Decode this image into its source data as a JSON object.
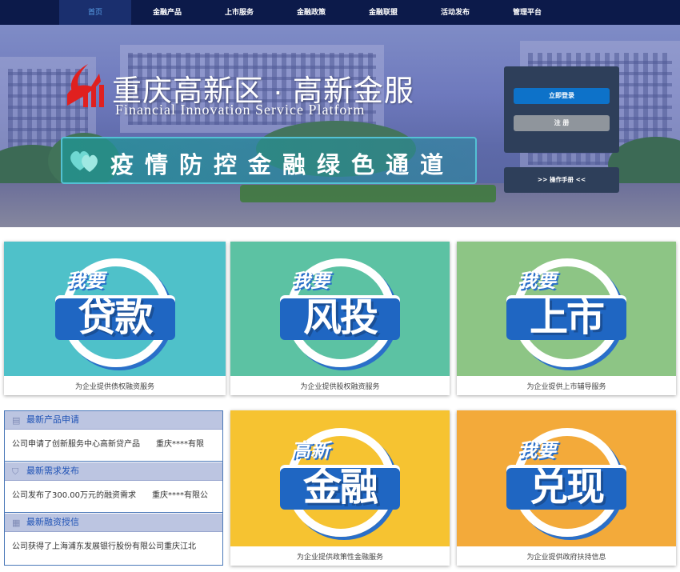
{
  "nav": {
    "items": [
      "首页",
      "金融产品",
      "上市服务",
      "金融政策",
      "金融联盟",
      "活动发布",
      "管理平台"
    ],
    "active_index": 0
  },
  "banner": {
    "title_cn": "重庆高新区 · 高新金服",
    "title_en": "Financial Innovation Service Platform",
    "promo": "疫情防控金融绿色通道",
    "login_label": "立即登录",
    "register_label": "注 册",
    "manual_label": ">> 操作手册 <<"
  },
  "cards": [
    {
      "small": "我要",
      "big": "贷款",
      "caption": "为企业提供债权融资服务",
      "bg": "#4fc1c9"
    },
    {
      "small": "我要",
      "big": "风投",
      "caption": "为企业提供股权融资服务",
      "bg": "#5cc2a3"
    },
    {
      "small": "我要",
      "big": "上市",
      "caption": "为企业提供上市辅导服务",
      "bg": "#8dc585"
    },
    {
      "small": "高新",
      "big": "金融",
      "caption": "为企业提供政策性金融服务",
      "bg": "#f6c331"
    },
    {
      "small": "我要",
      "big": "兑现",
      "caption": "为企业提供政府扶持信息",
      "bg": "#f3aa3a"
    }
  ],
  "news": {
    "sections": [
      {
        "title": "最新产品申请",
        "row": "公司申请了创新服务中心高新贷产品　　重庆****有限",
        "icon": "document-icon"
      },
      {
        "title": "最新需求发布",
        "row": "公司发布了300.00万元的融资需求　　重庆****有限公",
        "icon": "shield-icon"
      },
      {
        "title": "最新融资授信",
        "row": "公司获得了上海浦东发展银行股份有限公司重庆江北",
        "icon": "building-icon"
      }
    ]
  },
  "colors": {
    "nav_bg": "#0c1a4a",
    "nav_active": "#5aa0e8",
    "login_btn": "#0d72c9",
    "register_btn": "#8f959c",
    "panel": "#2e3f5a",
    "news_border": "#4a78b8",
    "news_head": "#bcc5e1",
    "news_title": "#1f52b5"
  }
}
